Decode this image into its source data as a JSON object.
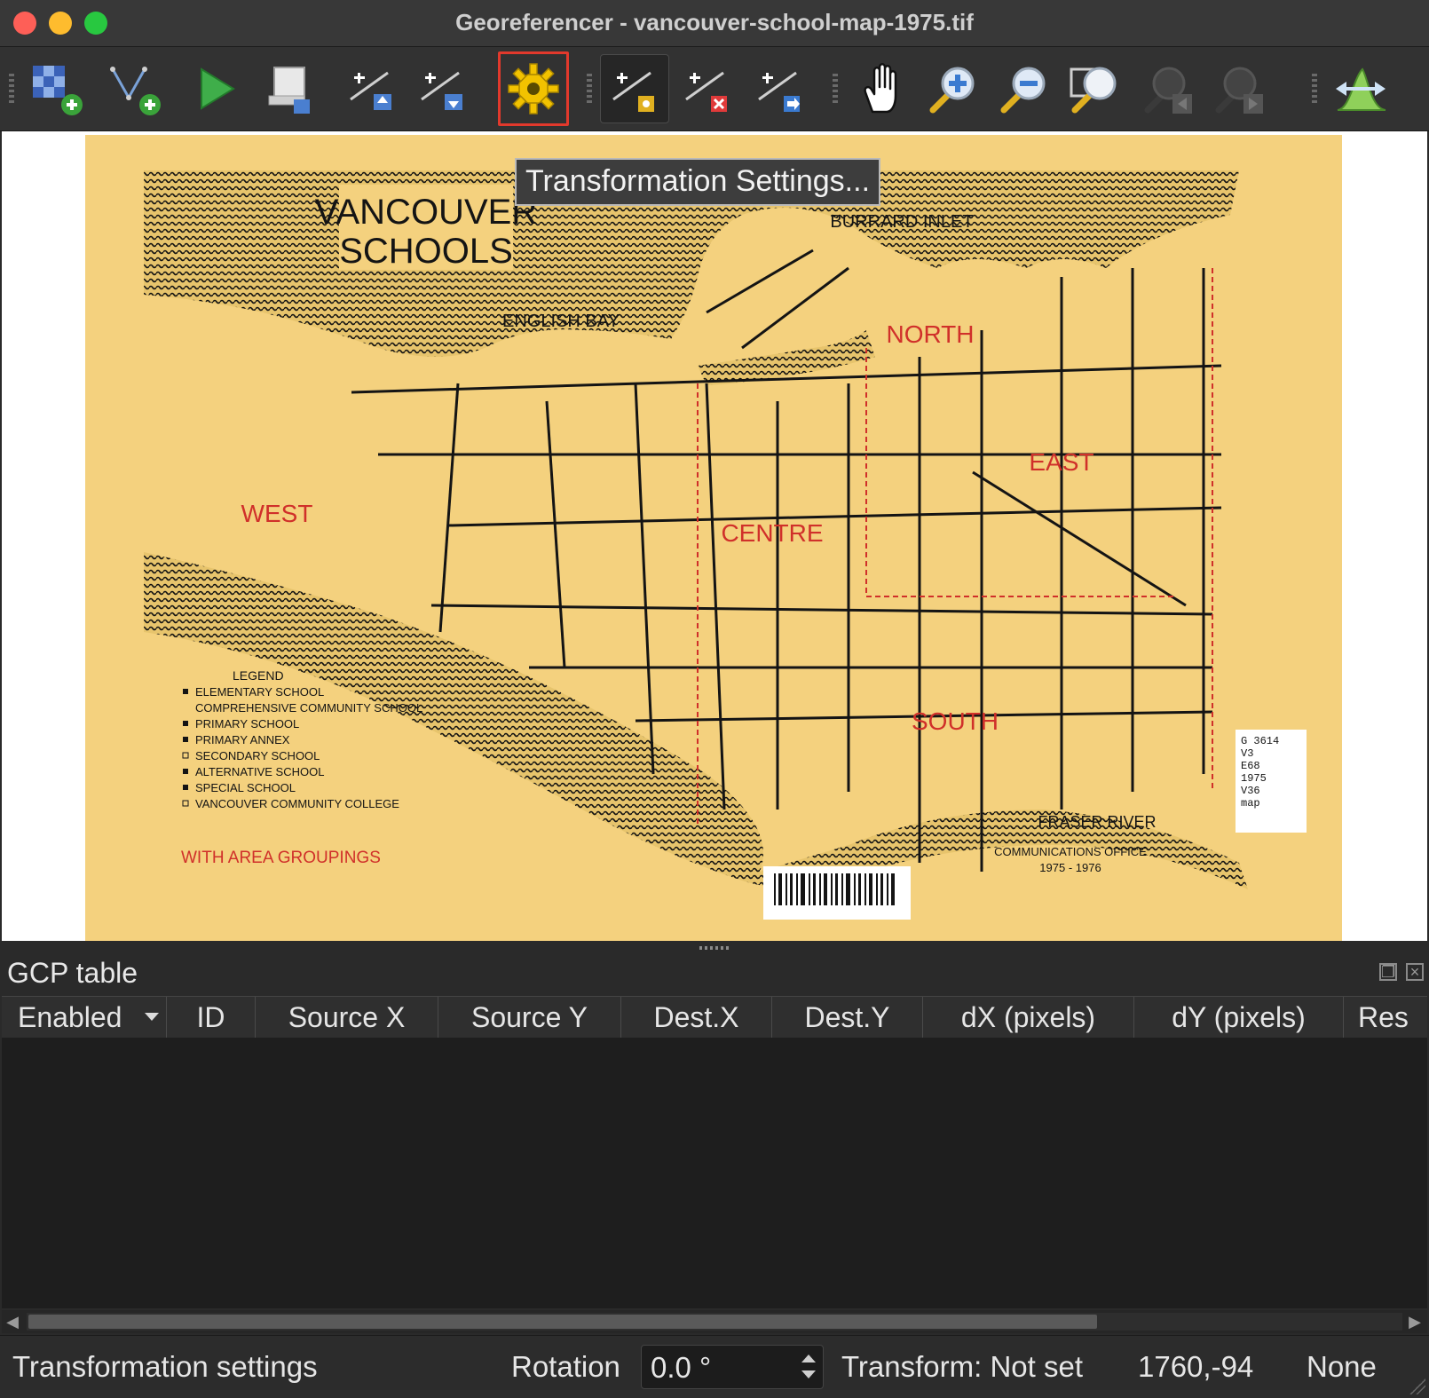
{
  "window": {
    "title": "Georeferencer - vancouver-school-map-1975.tif"
  },
  "toolbar": {
    "buttons": [
      {
        "name": "open-raster",
        "icon": "raster-add-icon"
      },
      {
        "name": "add-gcp-point",
        "icon": "point-add-icon"
      },
      {
        "name": "start-georeferencing",
        "icon": "play-icon"
      },
      {
        "name": "generate-gdal-script",
        "icon": "script-icon"
      },
      {
        "name": "load-gcp-points",
        "icon": "gcp-load-icon"
      },
      {
        "name": "save-gcp-points",
        "icon": "gcp-save-icon"
      },
      {
        "name": "transformation-settings",
        "icon": "gear-icon",
        "highlighted": true
      },
      {
        "name": "add-point",
        "icon": "add-point-icon",
        "pressed": true
      },
      {
        "name": "delete-point",
        "icon": "delete-point-icon"
      },
      {
        "name": "move-gcp-point",
        "icon": "move-point-icon"
      },
      {
        "name": "pan",
        "icon": "hand-icon"
      },
      {
        "name": "zoom-in",
        "icon": "zoom-in-icon"
      },
      {
        "name": "zoom-out",
        "icon": "zoom-out-icon"
      },
      {
        "name": "zoom-to-layer",
        "icon": "zoom-full-icon"
      },
      {
        "name": "zoom-last",
        "icon": "zoom-last-icon"
      },
      {
        "name": "zoom-next",
        "icon": "zoom-next-icon"
      },
      {
        "name": "link-georeferencer",
        "icon": "link-icon"
      }
    ]
  },
  "tooltip": {
    "text": "Transformation Settings..."
  },
  "map": {
    "title_line1": "VANCOUVER",
    "title_line2": "SCHOOLS",
    "regions": [
      "NORTH",
      "EAST",
      "WEST",
      "CENTRE",
      "SOUTH"
    ],
    "water_labels": [
      "BURRARD INLET",
      "ENGLISH BAY",
      "FRASER RIVER"
    ],
    "legend_title": "LEGEND",
    "legend_items": [
      "ELEMENTARY SCHOOL",
      "COMPREHENSIVE COMMUNITY SCHOOL",
      "PRIMARY SCHOOL",
      "PRIMARY ANNEX",
      "SECONDARY SCHOOL",
      "ALTERNATIVE SCHOOL",
      "SPECIAL SCHOOL",
      "VANCOUVER COMMUNITY COLLEGE"
    ],
    "subtitle": "WITH AREA GROUPINGS",
    "office_line1": "COMMUNICATIONS OFFICE",
    "office_line2": "1975 - 1976",
    "call_number": [
      "G 3614",
      "V3",
      "E68",
      "1975",
      "V36",
      "map"
    ],
    "colors": {
      "paper": "#f4d17e",
      "ink": "#141414",
      "red_labels": "#d0302a"
    }
  },
  "gcp_panel": {
    "title": "GCP table",
    "columns": [
      "Enabled",
      "ID",
      "Source X",
      "Source Y",
      "Dest.X",
      "Dest.Y",
      "dX (pixels)",
      "dY (pixels)",
      "Res"
    ],
    "rows": []
  },
  "statusbar": {
    "label": "Transformation settings",
    "rotation_label": "Rotation",
    "rotation_value": "0.0 °",
    "transform_status": "Transform: Not set",
    "coordinates": "1760,-94",
    "crs": "None"
  }
}
